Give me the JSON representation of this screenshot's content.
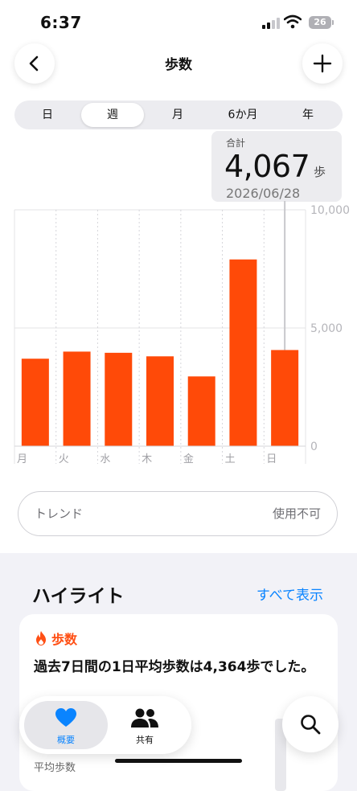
{
  "status_bar": {
    "time": "6:37",
    "battery": "26"
  },
  "nav": {
    "title": "歩数"
  },
  "segments": [
    "日",
    "週",
    "月",
    "6か月",
    "年"
  ],
  "selected_segment": "週",
  "tooltip": {
    "label": "合計",
    "value": "4,067",
    "unit": "歩",
    "date": "2026/06/28"
  },
  "chart_data": {
    "type": "bar",
    "categories": [
      "月",
      "火",
      "水",
      "木",
      "金",
      "土",
      "日"
    ],
    "values": [
      3700,
      4000,
      3950,
      3800,
      2950,
      7900,
      4067
    ],
    "ylim": [
      0,
      10000
    ],
    "yticks": [
      "0",
      "5,000",
      "10,000"
    ],
    "ytick_values": [
      0,
      5000,
      10000
    ],
    "selected_index": 6,
    "bar_color": "#ff4a08",
    "grid": true
  },
  "trend": {
    "label": "トレンド",
    "value": "使用不可"
  },
  "highlights": {
    "title": "ハイライト",
    "show_all": "すべて表示",
    "card": {
      "category": "歩数",
      "text": "過去7日間の1日平均歩数は4,364歩でした。",
      "sub": "平均歩数"
    }
  },
  "tabs": [
    {
      "label": "概要",
      "icon": "heart-icon",
      "active": true
    },
    {
      "label": "共有",
      "icon": "people-icon",
      "active": false
    }
  ],
  "colors": {
    "accent": "#ff4a08",
    "link": "#0a84ff",
    "active_tab": "#0a84ff"
  }
}
